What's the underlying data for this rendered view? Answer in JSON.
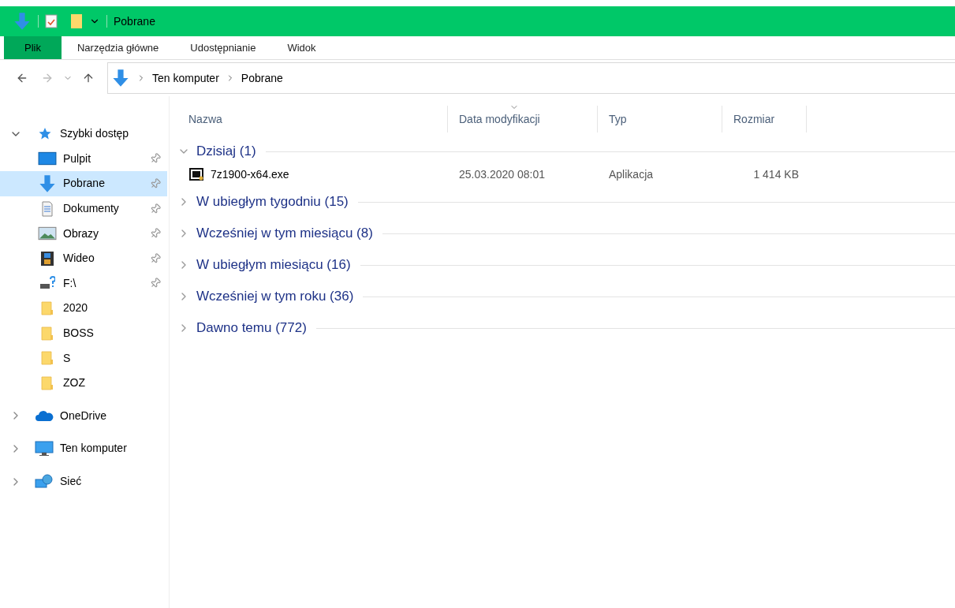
{
  "window": {
    "title": "Pobrane"
  },
  "ribbon_tabs": [
    {
      "label": "Plik",
      "selected": true
    },
    {
      "label": "Narzędzia główne",
      "selected": false
    },
    {
      "label": "Udostępnianie",
      "selected": false
    },
    {
      "label": "Widok",
      "selected": false
    }
  ],
  "address_bar": {
    "path": [
      "Ten komputer",
      "Pobrane"
    ]
  },
  "sidebar": {
    "items": [
      {
        "label": "Szybki dostęp",
        "kind": "star",
        "expanded": true,
        "selected": false,
        "children": [
          {
            "label": "Pulpit",
            "kind": "desktop",
            "pinned": true,
            "selected": false
          },
          {
            "label": "Pobrane",
            "kind": "download",
            "pinned": true,
            "selected": true
          },
          {
            "label": "Dokumenty",
            "kind": "document",
            "pinned": true,
            "selected": false
          },
          {
            "label": "Obrazy",
            "kind": "image",
            "pinned": true,
            "selected": false
          },
          {
            "label": "Wideo",
            "kind": "video",
            "pinned": true,
            "selected": false
          },
          {
            "label": "F:\\",
            "kind": "drive",
            "pinned": true,
            "selected": false
          },
          {
            "label": "2020",
            "kind": "folder",
            "pinned": false,
            "selected": false
          },
          {
            "label": "BOSS",
            "kind": "folder",
            "pinned": false,
            "selected": false
          },
          {
            "label": "S",
            "kind": "folder",
            "pinned": false,
            "selected": false
          },
          {
            "label": "ZOZ",
            "kind": "folder",
            "pinned": false,
            "selected": false
          }
        ]
      },
      {
        "label": "OneDrive",
        "kind": "cloud",
        "expanded": false,
        "selected": false
      },
      {
        "label": "Ten komputer",
        "kind": "computer",
        "expanded": false,
        "selected": false
      },
      {
        "label": "Sieć",
        "kind": "network",
        "expanded": false,
        "selected": false
      }
    ]
  },
  "file_list": {
    "columns": [
      "Nazwa",
      "Data modyfikacji",
      "Typ",
      "Rozmiar"
    ],
    "groups": [
      {
        "label": "Dzisiaj (1)",
        "expanded": true,
        "rows": [
          {
            "name": "7z1900-x64.exe",
            "date": "25.03.2020 08:01",
            "type": "Aplikacja",
            "size": "1 414 KB"
          }
        ]
      },
      {
        "label": "W ubiegłym tygodniu (15)",
        "expanded": false
      },
      {
        "label": "Wcześniej w tym miesiącu (8)",
        "expanded": false
      },
      {
        "label": "W ubiegłym miesiącu (16)",
        "expanded": false
      },
      {
        "label": "Wcześniej w tym roku (36)",
        "expanded": false
      },
      {
        "label": "Dawno temu (772)",
        "expanded": false
      }
    ]
  }
}
